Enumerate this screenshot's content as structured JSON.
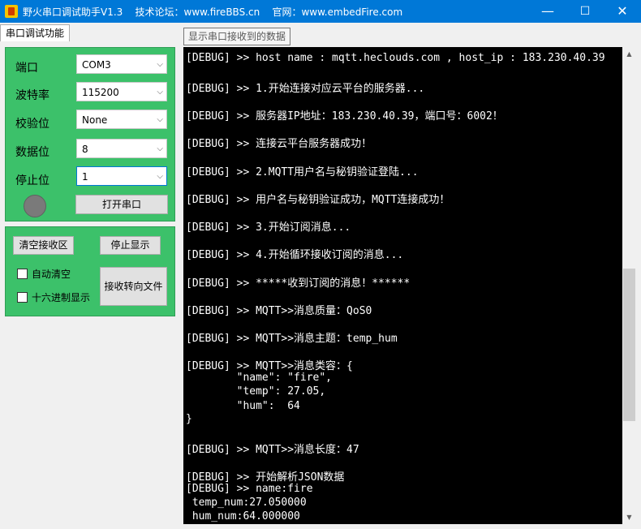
{
  "window": {
    "title": "野火串口调试助手V1.3    技术论坛：www.fireBBS.cn    官网：www.embedFire.com",
    "minimize": "—",
    "maximize": "☐",
    "close": "✕"
  },
  "tab": {
    "label": "串口调试功能"
  },
  "tooltip": "显示串口接收到的数据",
  "settings": {
    "port_label": "端口",
    "port_value": "COM3",
    "baud_label": "波特率",
    "baud_value": "115200",
    "parity_label": "校验位",
    "parity_value": "None",
    "databits_label": "数据位",
    "databits_value": "8",
    "stopbits_label": "停止位",
    "stopbits_value": "1",
    "open_button": "打开串口"
  },
  "receive": {
    "clear_button": "清空接收区",
    "stop_button": "停止显示",
    "auto_clear": "自动清空",
    "hex_display": "十六进制显示",
    "to_file_button": "接收转向文件"
  },
  "terminal_lines": [
    "[DEBUG] >> host name : mqtt.heclouds.com , host_ip : 183.230.40.39",
    "[DEBUG] >> 1.开始连接对应云平台的服务器...",
    "[DEBUG] >> 服务器IP地址：183.230.40.39，端口号：6002！",
    "[DEBUG] >> 连接云平台服务器成功！",
    "[DEBUG] >> 2.MQTT用户名与秘钥验证登陆...",
    "[DEBUG] >> 用户名与秘钥验证成功，MQTT连接成功！",
    "[DEBUG] >> 3.开始订阅消息...",
    "[DEBUG] >> 4.开始循环接收订阅的消息...",
    "[DEBUG] >> *****收到订阅的消息！******",
    "[DEBUG] >> MQTT>>消息质量：QoS0",
    "[DEBUG] >> MQTT>>消息主题：temp_hum",
    "[DEBUG] >> MQTT>>消息类容：{",
    "        \"name\": \"fire\",",
    "        \"temp\": 27.05,",
    "        \"hum\":  64",
    "}",
    "[DEBUG] >> MQTT>>消息长度：47",
    "[DEBUG] >> 开始解析JSON数据",
    "[DEBUG] >> name:fire",
    " temp_num:27.050000",
    " hum_num:64.000000"
  ],
  "scrollbar": {
    "up": "▲",
    "down": "▼"
  },
  "colors": {
    "titlebar": "#0078d7",
    "panel": "#3cc16a",
    "terminal_bg": "#000000",
    "terminal_fg": "#ffffff"
  }
}
